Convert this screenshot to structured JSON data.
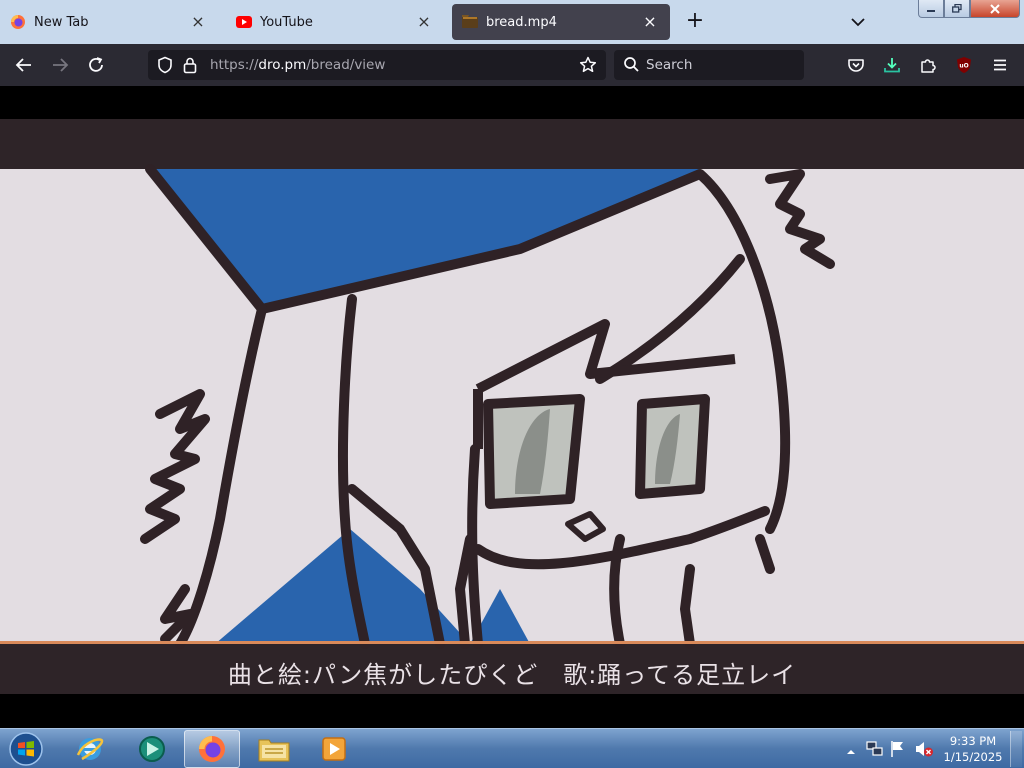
{
  "browser": {
    "tabs": [
      {
        "label": "New Tab",
        "icon": "firefox-icon"
      },
      {
        "label": "YouTube",
        "icon": "youtube-icon"
      },
      {
        "label": "bread.mp4",
        "icon": "video-file-icon",
        "active": true
      }
    ],
    "new_tab_label": "+",
    "url": {
      "scheme": "https://",
      "host": "dro.pm",
      "path": "/bread/view"
    },
    "search_placeholder": "Search",
    "accent": "#2b2a33"
  },
  "video": {
    "subtitle": "曲と絵:パン焦がしたぴくど　歌:踊ってる足立レイ"
  },
  "taskbar": {
    "apps": [
      "internet-explorer-icon",
      "media-app-icon",
      "firefox-icon",
      "file-explorer-icon",
      "media-player-icon"
    ],
    "clock_time": "9:33 PM",
    "clock_date": "1/15/2025"
  }
}
